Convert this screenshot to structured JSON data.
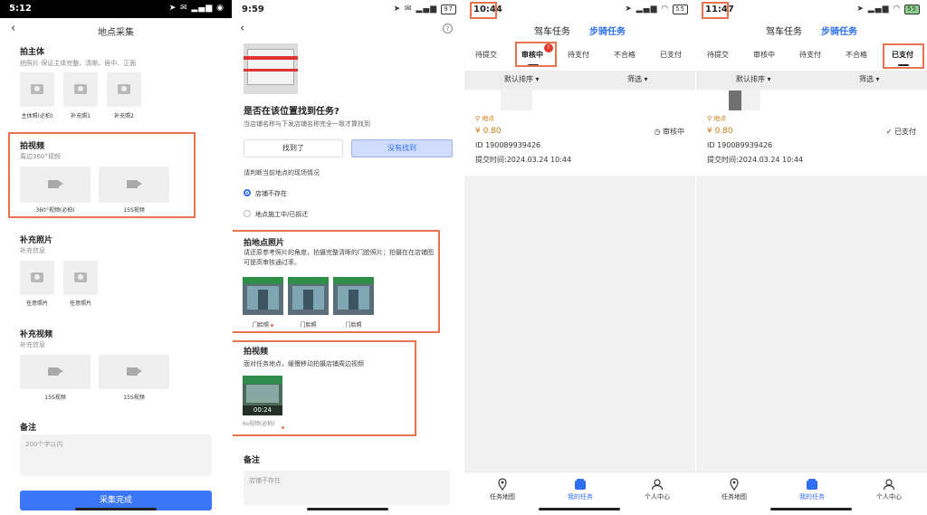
{
  "colors": {
    "accent_blue": "#2f6ff0",
    "highlight_orange": "#e8734f",
    "price_orange": "#c97c10",
    "badge_red": "#e23a2e"
  },
  "s1": {
    "time": "5:12",
    "title": "地点采集",
    "main": {
      "title": "拍主体",
      "sub": "拍照片  保证主体完整、清晰、居中、正面",
      "photos": [
        "主体照(必拍)",
        "补充照1",
        "补充照2"
      ]
    },
    "video": {
      "title": "拍视频",
      "sub": "周边360°视频",
      "items": [
        "360°视频(必拍)",
        "15S视频"
      ]
    },
    "extra_photo": {
      "title": "补充照片",
      "sub": "补充信息",
      "items": [
        "任意照片",
        "任意照片"
      ]
    },
    "extra_video": {
      "title": "补充视频",
      "sub": "补充信息",
      "items": [
        "15S视频",
        "15S视频"
      ]
    },
    "note": {
      "title": "备注",
      "placeholder": "200个字以内"
    },
    "submit": "采集完成"
  },
  "s2": {
    "time": "9:59",
    "battery": "97",
    "question": "是否在该位置找到任务?",
    "hint": "当店铺名称与下发店铺名称完全一致才算找到",
    "found": "找到了",
    "not_found": "没有找到",
    "judge": "请判断当前地点的现场情况",
    "opt1": "店铺不存在",
    "opt2": "地点施工中/已拆迁",
    "photo_title": "拍地点照片",
    "photo_desc": "请还原参考照片的角度，拍摄完整清晰的门脸照片；拍摄在在店铺图可提高审核通过率。",
    "photo_caps": [
      "门脸照",
      "门脸照",
      "门脸照"
    ],
    "video_title": "拍视频",
    "video_desc": "面对任务地点，缓慢移动拍摄店铺周边视频",
    "video_duration": "00:24",
    "video_cap": "6s视频(必拍)",
    "note_title": "备注",
    "note_value": "店铺不存在"
  },
  "s3": {
    "time": "10:44",
    "battery": "55",
    "top_tabs": [
      "驾车任务",
      "步骑任务"
    ],
    "sub_tabs": [
      "待提交",
      "审核中",
      "待支付",
      "不合格",
      "已支付"
    ],
    "badge": "!",
    "sort": "默认排序",
    "filter": "筛选",
    "card": {
      "loc": "地点",
      "price": "¥ 0.80",
      "status": "审核中",
      "id": "ID 190089939426",
      "time": "提交时间:2024.03.24 10:44"
    },
    "nav": [
      "任务地图",
      "我的任务",
      "个人中心"
    ]
  },
  "s4": {
    "time": "11:47",
    "battery": "55",
    "top_tabs": [
      "驾车任务",
      "步骑任务"
    ],
    "sub_tabs": [
      "待提交",
      "审核中",
      "待支付",
      "不合格",
      "已支付"
    ],
    "sort": "默认排序",
    "filter": "筛选",
    "card": {
      "loc": "地点",
      "price": "¥ 0.80",
      "status": "已支付",
      "id": "ID 190089939426",
      "time": "提交时间:2024.03.24 10:44"
    },
    "nav": [
      "任务地图",
      "我的任务",
      "个人中心"
    ]
  }
}
